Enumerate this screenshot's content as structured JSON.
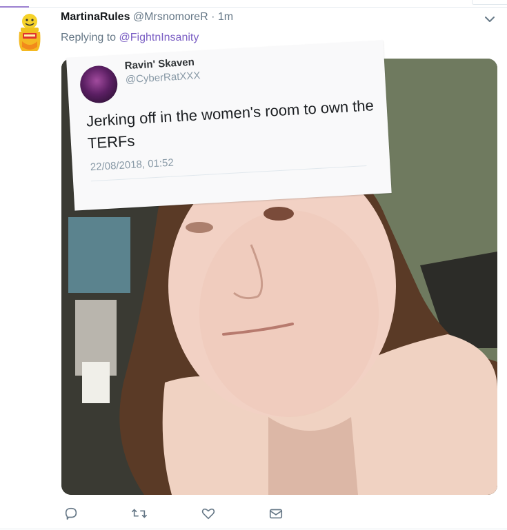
{
  "tweet": {
    "display_name": "MartinaRules",
    "handle": "@MrsnomoreR",
    "separator": "·",
    "time": "1m",
    "replying_prefix": "Replying to",
    "replying_to": "@FightnInsanity"
  },
  "embedded_tweet": {
    "display_name": "Ravin' Skaven",
    "handle": "@CyberRatXXX",
    "text": "Jerking off in the women's room to own the TERFs",
    "date": "22/08/2018, 01:52"
  },
  "icons": {
    "avatar": "honey-jar-avatar",
    "more": "chevron-down-icon",
    "reply": "reply-icon",
    "retweet": "retweet-icon",
    "like": "heart-icon",
    "dm": "envelope-icon"
  },
  "colors": {
    "link": "#7b5fc4",
    "muted": "#657786",
    "icon": "#657786"
  }
}
